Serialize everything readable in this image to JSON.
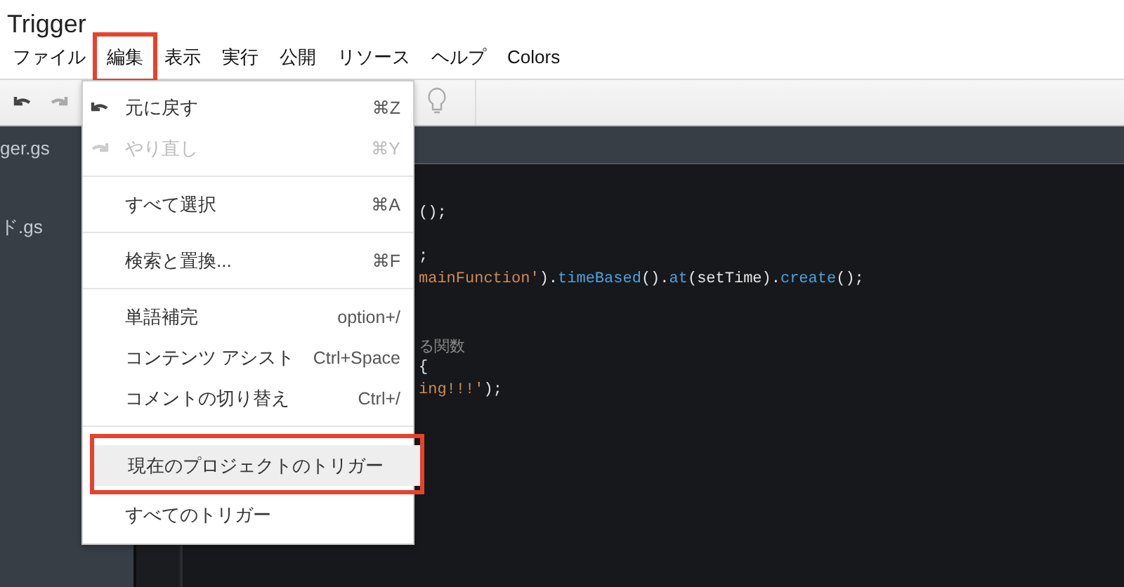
{
  "window": {
    "title": "Trigger"
  },
  "menubar": [
    {
      "label": "ファイル",
      "highlighted": false
    },
    {
      "label": "編集",
      "highlighted": true
    },
    {
      "label": "表示",
      "highlighted": false
    },
    {
      "label": "実行",
      "highlighted": false
    },
    {
      "label": "公開",
      "highlighted": false
    },
    {
      "label": "リソース",
      "highlighted": false
    },
    {
      "label": "ヘルプ",
      "highlighted": false
    },
    {
      "label": "Colors",
      "highlighted": false
    }
  ],
  "sidebar": {
    "files": [
      {
        "name": "ger.gs"
      },
      {
        "name": "ド.gs"
      }
    ]
  },
  "editor": {
    "lines": [
      {
        "kind": "code",
        "tokens": [
          {
            "kind": "plain",
            "text": "();"
          }
        ]
      },
      {
        "kind": "blank"
      },
      {
        "kind": "code",
        "tokens": [
          {
            "kind": "plain",
            "text": ";"
          }
        ]
      },
      {
        "kind": "code",
        "tokens": [
          {
            "kind": "string",
            "text": "mainFunction'"
          },
          {
            "kind": "plain",
            "text": ")."
          },
          {
            "kind": "method",
            "text": "timeBased"
          },
          {
            "kind": "plain",
            "text": "()."
          },
          {
            "kind": "method",
            "text": "at"
          },
          {
            "kind": "plain",
            "text": "(setTime)."
          },
          {
            "kind": "method",
            "text": "create"
          },
          {
            "kind": "plain",
            "text": "();"
          }
        ]
      },
      {
        "kind": "blank"
      },
      {
        "kind": "blank"
      },
      {
        "kind": "code",
        "tokens": [
          {
            "kind": "comment",
            "text": "る関数"
          }
        ]
      },
      {
        "kind": "code",
        "tokens": [
          {
            "kind": "plain",
            "text": "{"
          }
        ]
      },
      {
        "kind": "code",
        "tokens": [
          {
            "kind": "string",
            "text": "ing!!!'"
          },
          {
            "kind": "plain",
            "text": ");"
          }
        ]
      }
    ]
  },
  "dropdown": {
    "items": [
      {
        "kind": "undo",
        "label": "元に戻す",
        "shortcut": "⌘Z",
        "disabled": false,
        "selected": false,
        "highlighted": false
      },
      {
        "kind": "redo",
        "label": "やり直し",
        "shortcut": "⌘Y",
        "disabled": true,
        "selected": false,
        "highlighted": false
      },
      {
        "kind": "separator"
      },
      {
        "kind": "item",
        "label": "すべて選択",
        "shortcut": "⌘A",
        "disabled": false,
        "selected": false,
        "highlighted": false
      },
      {
        "kind": "separator"
      },
      {
        "kind": "item",
        "label": "検索と置換...",
        "shortcut": "⌘F",
        "disabled": false,
        "selected": false,
        "highlighted": false
      },
      {
        "kind": "separator"
      },
      {
        "kind": "item",
        "label": "単語補完",
        "shortcut": "option+/",
        "disabled": false,
        "selected": false,
        "highlighted": false
      },
      {
        "kind": "item",
        "label": "コンテンツ アシスト",
        "shortcut": "Ctrl+Space",
        "disabled": false,
        "selected": false,
        "highlighted": false
      },
      {
        "kind": "item",
        "label": "コメントの切り替え",
        "shortcut": "Ctrl+/",
        "disabled": false,
        "selected": false,
        "highlighted": false
      },
      {
        "kind": "separator"
      },
      {
        "kind": "item",
        "label": "現在のプロジェクトのトリガー",
        "disabled": false,
        "selected": true,
        "highlighted": true
      },
      {
        "kind": "item",
        "label": "すべてのトリガー",
        "disabled": false,
        "selected": false,
        "highlighted": false
      }
    ]
  }
}
